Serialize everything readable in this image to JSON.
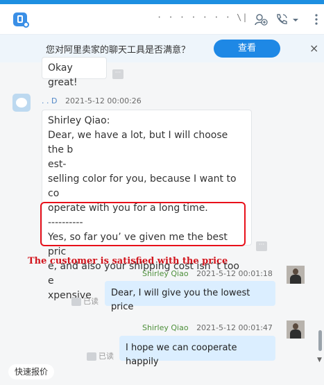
{
  "header": {
    "chat_title": "·  ·  ·  ·  ·  · · \\|",
    "icons": [
      "app-icon",
      "add-contact-icon",
      "phone-call-icon",
      "caret-down-icon",
      "more-vertical-icon"
    ]
  },
  "survey": {
    "text": "您对阿里卖家的聊天工具是否满意？",
    "button": "查看",
    "close": "×"
  },
  "messages": {
    "first": {
      "text": "Okay great!"
    },
    "second": {
      "sender": ". . D",
      "timestamp": "2021-5-12 00:00:26",
      "lines": [
        "Shirley Qiao:",
        "Dear, we have a lot, but I will choose the b",
        "est-",
        "selling color for you, because I want to co",
        "operate with you for a long time.",
        "----------"
      ],
      "highlight_lines": [
        "Yes, so far you’ ve given me the best pric",
        "e, and also your shipping cost isn’ t too e",
        "xpensive"
      ]
    },
    "annotation": "The customer is satisfied with the price",
    "third": {
      "sender": "Shirley Qiao",
      "timestamp": "2021-5-12 00:01:18",
      "text": "Dear, I will give you the lowest price",
      "status": "已读"
    },
    "fourth": {
      "sender": "Shirley Qiao",
      "timestamp": "2021-5-12 00:01:47",
      "text": "I hope we can cooperate happily",
      "status": "已读"
    }
  },
  "quick_reply": "快速报价",
  "more_dots": "···"
}
